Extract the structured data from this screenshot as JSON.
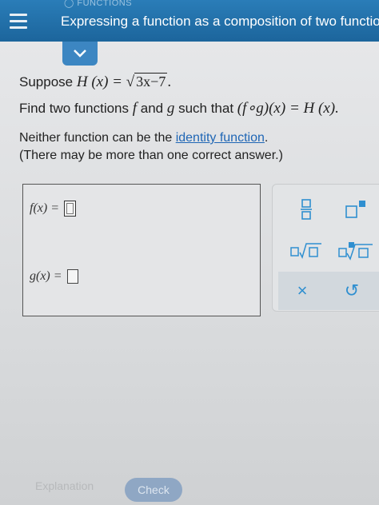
{
  "header": {
    "topic": "FUNCTIONS",
    "title": "Expressing a function as a composition of two functions"
  },
  "question": {
    "suppose_label": "Suppose ",
    "h_of_x": "H (x) = ",
    "radicand": "3x−7",
    "period": ".",
    "find_prefix": "Find two functions ",
    "f_letter": "f",
    "and_text": " and ",
    "g_letter": "g",
    "such_that": " such that ",
    "composition": "(f∘g)(x) = H (x).",
    "neither_prefix": "Neither function can be the ",
    "identity_link": "identity function",
    "neither_suffix": ".",
    "note": "(There may be more than one correct answer.)"
  },
  "answers": {
    "f_label": "f(x)  =",
    "g_label": "g(x)  =",
    "f_value": "",
    "g_value": ""
  },
  "toolbox": {
    "clear_symbol": "×",
    "undo_symbol": "↺"
  },
  "footer": {
    "explanation_label": "Explanation",
    "check_label": "Check"
  },
  "colors": {
    "header_bg": "#1f6fa8",
    "accent": "#2f8fd0",
    "link": "#1f66b5"
  }
}
